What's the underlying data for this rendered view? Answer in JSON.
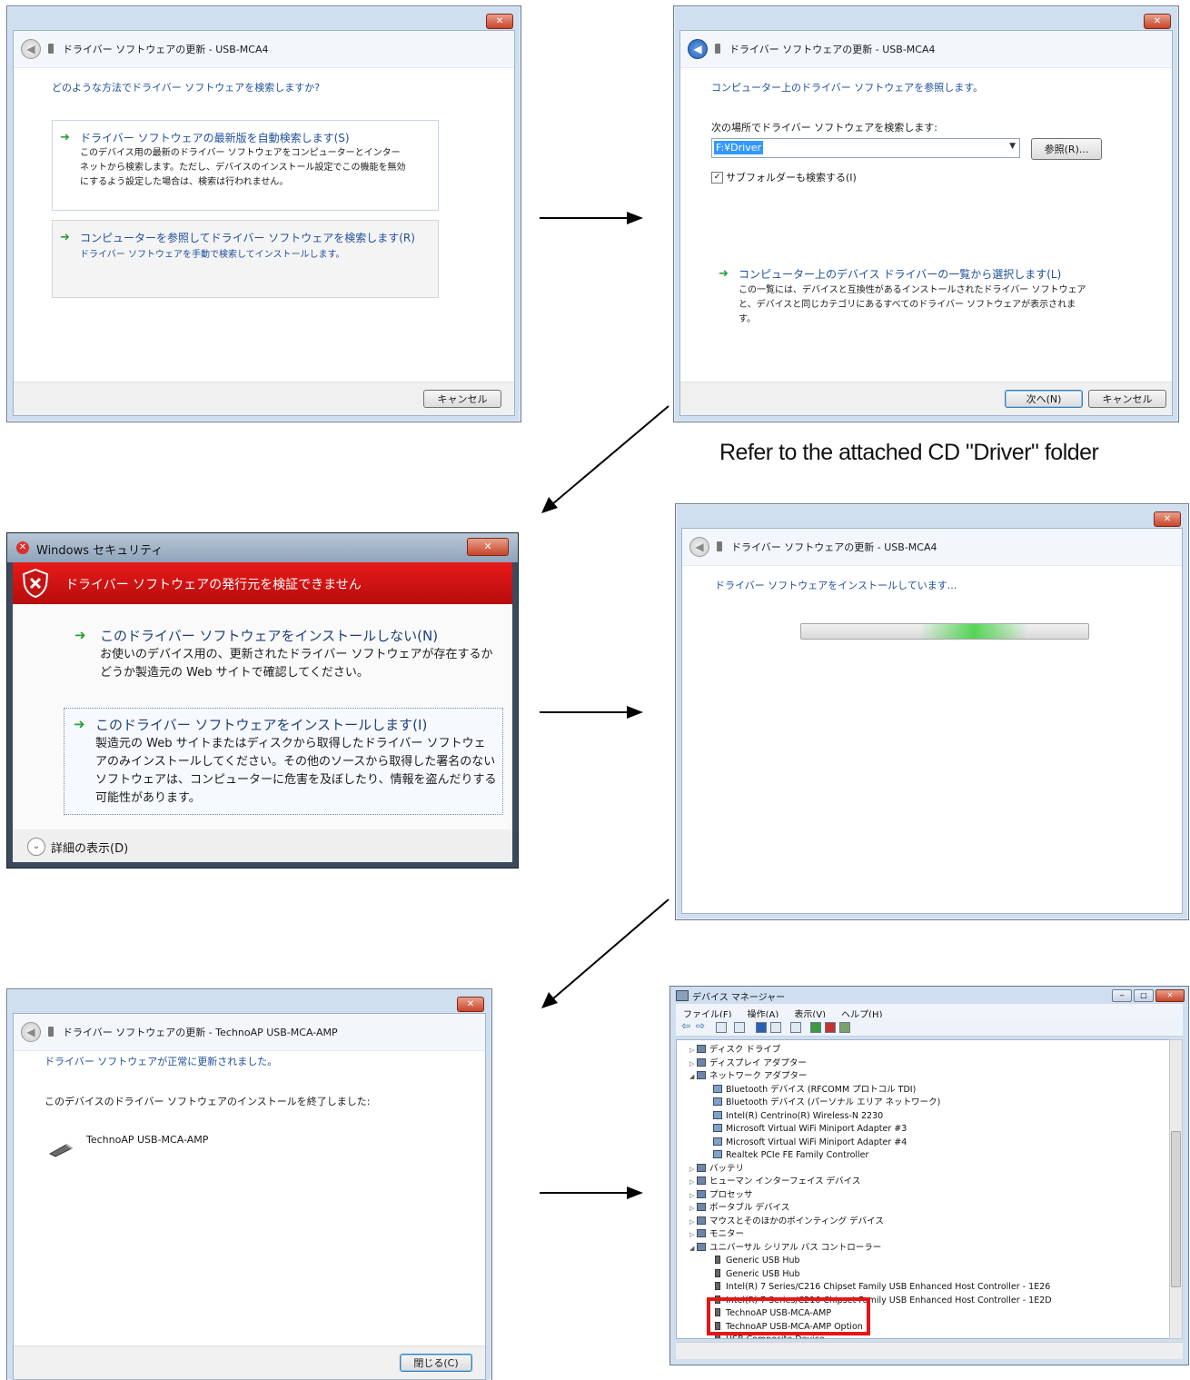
{
  "dialog1": {
    "title": "ドライバー ソフトウェアの更新 - USB-MCA4",
    "question": "どのような方法でドライバー ソフトウェアを検索しますか?",
    "option1_title": "ドライバー ソフトウェアの最新版を自動検索します(S)",
    "option1_line1": "このデバイス用の最新のドライバー ソフトウェアをコンピューターとインター",
    "option1_line2": "ネットから検索します。ただし、デバイスのインストール設定でこの機能を無効",
    "option1_line3": "にするよう設定した場合は、検索は行われません。",
    "option2_title": "コンピューターを参照してドライバー ソフトウェアを検索します(R)",
    "option2_line1": "ドライバー ソフトウェアを手動で検索してインストールします。",
    "cancel_label": "キャンセル"
  },
  "dialog2": {
    "title": "ドライバー ソフトウェアの更新 - USB-MCA4",
    "heading": "コンピューター上のドライバー ソフトウェアを参照します。",
    "location_label": "次の場所でドライバー ソフトウェアを検索します:",
    "path_value": "F:¥Driver",
    "browse_label": "参照(R)...",
    "subfolder_label": "サブフォルダーも検索する(I)",
    "subfolder_checked": true,
    "list_option_title": "コンピューター上のデバイス ドライバーの一覧から選択します(L)",
    "list_option_line1": "この一覧には、デバイスと互換性があるインストールされたドライバー ソフトウェア",
    "list_option_line2": "と、デバイスと同じカテゴリにあるすべてのドライバー ソフトウェアが表示されま",
    "list_option_line3": "す。",
    "next_label": "次へ(N)",
    "cancel_label": "キャンセル"
  },
  "caption": "Refer to the attached CD \"Driver\" folder",
  "security": {
    "window_title": "Windows セキュリティ",
    "banner": "ドライバー ソフトウェアの発行元を検証できません",
    "opt1_title": "このドライバー ソフトウェアをインストールしない(N)",
    "opt1_line1": "お使いのデバイス用の、更新されたドライバー ソフトウェアが存在するか",
    "opt1_line2": "どうか製造元の Web サイトで確認してください。",
    "opt2_title": "このドライバー ソフトウェアをインストールします(I)",
    "opt2_line1": "製造元の Web サイトまたはディスクから取得したドライバー ソフトウェ",
    "opt2_line2": "アのみインストールしてください。その他のソースから取得した署名のない",
    "opt2_line3": "ソフトウェアは、コンピューターに危害を及ぼしたり、情報を盗んだりする",
    "opt2_line4": "可能性があります。",
    "details_label": "詳細の表示(D)"
  },
  "dialog4": {
    "title": "ドライバー ソフトウェアの更新 - USB-MCA4",
    "status": "ドライバー ソフトウェアをインストールしています..."
  },
  "dialog5": {
    "title": "ドライバー ソフトウェアの更新 - TechnoAP USB-MCA-AMP",
    "status": "ドライバー ソフトウェアが正常に更新されました。",
    "finished": "このデバイスのドライバー ソフトウェアのインストールを終了しました:",
    "device": "TechnoAP USB-MCA-AMP",
    "close_label": "閉じる(C)"
  },
  "device_manager": {
    "title": "デバイス マネージャー",
    "menu": [
      "ファイル(F)",
      "操作(A)",
      "表示(V)",
      "ヘルプ(H)"
    ],
    "tree": [
      {
        "level": 1,
        "exp": "▷",
        "label": "ディスク ドライブ"
      },
      {
        "level": 1,
        "exp": "▷",
        "label": "ディスプレイ アダプター"
      },
      {
        "level": 1,
        "exp": "◢",
        "label": "ネットワーク アダプター"
      },
      {
        "level": 2,
        "exp": "",
        "label": "Bluetooth デバイス (RFCOMM プロトコル TDI)"
      },
      {
        "level": 2,
        "exp": "",
        "label": "Bluetooth デバイス (パーソナル エリア ネットワーク)"
      },
      {
        "level": 2,
        "exp": "",
        "label": "Intel(R) Centrino(R) Wireless-N 2230"
      },
      {
        "level": 2,
        "exp": "",
        "label": "Microsoft Virtual WiFi Miniport Adapter #3"
      },
      {
        "level": 2,
        "exp": "",
        "label": "Microsoft Virtual WiFi Miniport Adapter #4"
      },
      {
        "level": 2,
        "exp": "",
        "label": "Realtek PCIe FE Family Controller"
      },
      {
        "level": 1,
        "exp": "▷",
        "label": "バッテリ"
      },
      {
        "level": 1,
        "exp": "▷",
        "label": "ヒューマン インターフェイス デバイス"
      },
      {
        "level": 1,
        "exp": "▷",
        "label": "プロセッサ"
      },
      {
        "level": 1,
        "exp": "▷",
        "label": "ポータブル デバイス"
      },
      {
        "level": 1,
        "exp": "▷",
        "label": "マウスとそのほかのポインティング デバイス"
      },
      {
        "level": 1,
        "exp": "▷",
        "label": "モニター"
      },
      {
        "level": 1,
        "exp": "◢",
        "label": "ユニバーサル シリアル バス コントローラー"
      },
      {
        "level": 2,
        "exp": "",
        "label": "Generic USB Hub"
      },
      {
        "level": 2,
        "exp": "",
        "label": "Generic USB Hub"
      },
      {
        "level": 2,
        "exp": "",
        "label": "Intel(R) 7 Series/C216 Chipset Family USB Enhanced Host Controller - 1E26"
      },
      {
        "level": 2,
        "exp": "",
        "label": "Intel(R) 7 Series/C216 Chipset Family USB Enhanced Host Controller - 1E2D"
      },
      {
        "level": 2,
        "exp": "",
        "label": "TechnoAP USB-MCA-AMP"
      },
      {
        "level": 2,
        "exp": "",
        "label": "TechnoAP USB-MCA-AMP Option"
      },
      {
        "level": 2,
        "exp": "",
        "label": "USB Composite Device"
      }
    ]
  }
}
